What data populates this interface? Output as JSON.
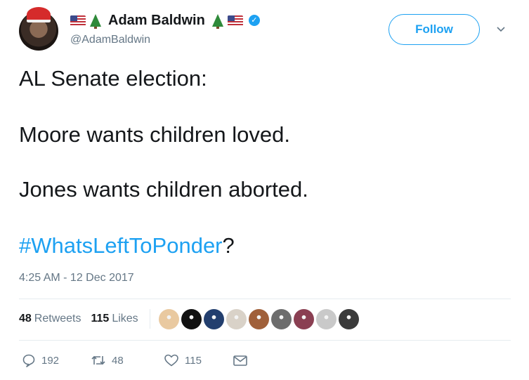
{
  "user": {
    "display_name": "Adam Baldwin",
    "handle": "@AdamBaldwin",
    "name_decorations": [
      "us-flag-icon",
      "christmas-tree-icon",
      "christmas-tree-icon",
      "us-flag-icon"
    ],
    "verified": true
  },
  "follow_label": "Follow",
  "tweet": {
    "lines": [
      "AL Senate election:",
      "Moore wants children loved.",
      "Jones wants children aborted."
    ],
    "hashtag": "#WhatsLeftToPonder",
    "hashtag_suffix": "?"
  },
  "timestamp": "4:25 AM - 12 Dec 2017",
  "stats": {
    "retweets_count": "48",
    "retweets_label": "Retweets",
    "likes_count": "115",
    "likes_label": "Likes"
  },
  "liker_avatars": [
    "#e9c9a0",
    "#111111",
    "#233f6e",
    "#d9d2c8",
    "#a0603a",
    "#6d6d6d",
    "#8a3f52",
    "#c9c9c9",
    "#3a3a3a"
  ],
  "actions": {
    "reply_count": "192",
    "retweet_count": "48",
    "like_count": "115"
  },
  "colors": {
    "accent": "#1da1f2",
    "secondary_text": "#657786",
    "primary_text": "#14171a"
  }
}
